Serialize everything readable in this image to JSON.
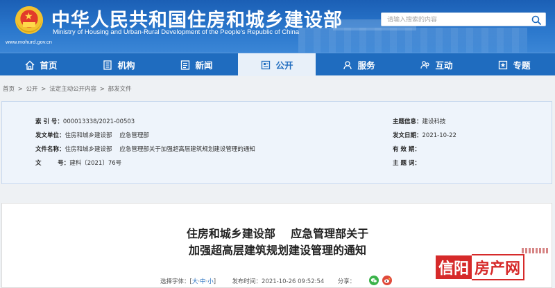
{
  "header": {
    "title_cn": "中华人民共和国住房和城乡建设部",
    "title_en": "Ministry of Housing and Urban-Rural Development of the People's Republic of China",
    "url": "www.mohurd.gov.cn",
    "search_placeholder": "请输入搜索的内容"
  },
  "nav": {
    "items": [
      {
        "label": "首页",
        "icon": "home-icon"
      },
      {
        "label": "机构",
        "icon": "building-icon"
      },
      {
        "label": "新闻",
        "icon": "news-icon"
      },
      {
        "label": "公开",
        "icon": "disclosure-icon"
      },
      {
        "label": "服务",
        "icon": "service-icon"
      },
      {
        "label": "互动",
        "icon": "interact-icon"
      },
      {
        "label": "专题",
        "icon": "topic-icon"
      }
    ],
    "active_index": 3
  },
  "breadcrumb": [
    "首页",
    "公开",
    "法定主动公开内容",
    "部发文件"
  ],
  "breadcrumb_sep": ">",
  "info": {
    "index_label": "索 引 号：",
    "index_value": "000013338/2021-00503",
    "issuer_label": "发文单位：",
    "issuer_value": "住房和城乡建设部    应急管理部",
    "filename_label": "文件名称：",
    "filename_value": "住房和城乡建设部    应急管理部关于加强超高层建筑规划建设管理的通知",
    "docno_label": "文        号：",
    "docno_value": "建科〔2021〕76号",
    "topic_label": "主题信息：",
    "topic_value": "建设科技",
    "date_label": "发文日期：",
    "date_value": "2021-10-22",
    "validity_label": "有 效 期：",
    "validity_value": "",
    "keywords_label": "主 题 词：",
    "keywords_value": ""
  },
  "article": {
    "title_line1": "住房和城乡建设部    应急管理部关于",
    "title_line2": "加强超高层建筑规划建设管理的通知",
    "font_label": "选择字体：[",
    "font_large": "大",
    "font_mid": "中",
    "font_small": "小",
    "font_close": "]",
    "sep": "·",
    "published_label": "发布时间：",
    "published_value": "2021-10-26 09:52:54",
    "share_label": "分享："
  },
  "watermark": {
    "part1": "信阳",
    "part2": "房产网"
  },
  "colors": {
    "brand_blue": "#1f6cbf",
    "watermark_red": "#d62a2a"
  }
}
